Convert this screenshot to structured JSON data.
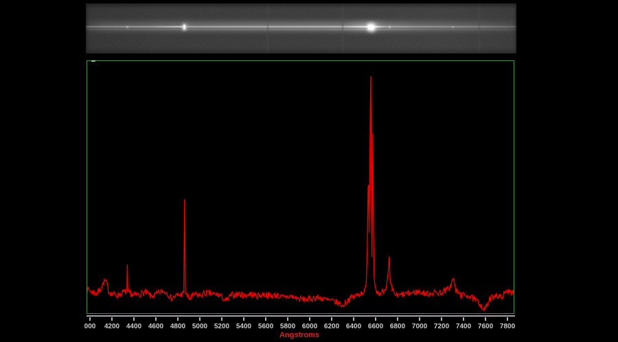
{
  "palette": {
    "background": "#000000",
    "strip_background": "#3b3b3b",
    "trace_white": "#ffffff",
    "plot_frame_green": "#3f9140",
    "spectrum_red": "#f20000",
    "axis_gray": "#a3a3a3",
    "tick_label_gray": "#cbcbcb",
    "xlabel_red": "#dd2222"
  },
  "strip": {
    "name": "2D spectrum strip image",
    "emission_knots": [
      {
        "lambda": 4340,
        "w": 3,
        "h": 3,
        "opacity": 0.35,
        "glow": 2
      },
      {
        "lambda": 4861,
        "w": 3,
        "h": 7,
        "opacity": 0.95,
        "glow": 3
      },
      {
        "lambda": 6541,
        "w": 3,
        "h": 7,
        "opacity": 1.0,
        "glow": 4
      },
      {
        "lambda": 6560,
        "w": 4,
        "h": 8,
        "opacity": 1.0,
        "glow": 5
      },
      {
        "lambda": 6579,
        "w": 3,
        "h": 6,
        "opacity": 0.95,
        "glow": 4
      },
      {
        "lambda": 6725,
        "w": 3,
        "h": 3,
        "opacity": 0.35,
        "glow": 2
      },
      {
        "lambda": 7306,
        "w": 3,
        "h": 3,
        "opacity": 0.25,
        "glow": 2
      }
    ],
    "vertical_streaks": [
      5612,
      6294,
      7537
    ]
  },
  "chart_data": {
    "type": "line",
    "title": "",
    "xlabel": "Angstroms",
    "ylabel": "",
    "x_range": [
      3975,
      7856
    ],
    "y_normalized_range": [
      0,
      1
    ],
    "grid": false,
    "legend": false,
    "line_color": "#f20000",
    "frame_color": "#3f9140",
    "x_ticks": {
      "values": [
        4000,
        4200,
        4400,
        4600,
        4800,
        5000,
        5200,
        5400,
        5600,
        5800,
        6000,
        6200,
        6400,
        6600,
        6800,
        7000,
        7200,
        7400,
        7600,
        7800
      ],
      "labels": [
        "000",
        "4200",
        "4400",
        "4600",
        "4800",
        "5000",
        "5200",
        "5400",
        "5600",
        "5800",
        "6000",
        "6200",
        "6400",
        "6600",
        "6800",
        "7000",
        "7200",
        "7400",
        "7600",
        "7800"
      ]
    },
    "noise_amplitude": 0.013,
    "series": [
      {
        "name": "intensity-profile",
        "points": [
          [
            3975,
            0.085
          ],
          [
            4020,
            0.075
          ],
          [
            4060,
            0.07
          ],
          [
            4100,
            0.09
          ],
          [
            4130,
            0.12
          ],
          [
            4150,
            0.115
          ],
          [
            4170,
            0.08
          ],
          [
            4210,
            0.07
          ],
          [
            4250,
            0.065
          ],
          [
            4300,
            0.08
          ],
          [
            4336,
            0.085
          ],
          [
            4340,
            0.18
          ],
          [
            4344,
            0.085
          ],
          [
            4390,
            0.07
          ],
          [
            4450,
            0.075
          ],
          [
            4500,
            0.085
          ],
          [
            4550,
            0.07
          ],
          [
            4600,
            0.075
          ],
          [
            4650,
            0.09
          ],
          [
            4700,
            0.085
          ],
          [
            4740,
            0.06
          ],
          [
            4790,
            0.07
          ],
          [
            4830,
            0.075
          ],
          [
            4854,
            0.08
          ],
          [
            4861,
            0.455
          ],
          [
            4868,
            0.08
          ],
          [
            4900,
            0.055
          ],
          [
            4950,
            0.07
          ],
          [
            5000,
            0.068
          ],
          [
            5060,
            0.075
          ],
          [
            5120,
            0.07
          ],
          [
            5180,
            0.065
          ],
          [
            5240,
            0.042
          ],
          [
            5290,
            0.065
          ],
          [
            5350,
            0.07
          ],
          [
            5400,
            0.065
          ],
          [
            5460,
            0.072
          ],
          [
            5520,
            0.065
          ],
          [
            5580,
            0.075
          ],
          [
            5640,
            0.07
          ],
          [
            5700,
            0.075
          ],
          [
            5760,
            0.068
          ],
          [
            5820,
            0.075
          ],
          [
            5880,
            0.07
          ],
          [
            5940,
            0.065
          ],
          [
            6000,
            0.068
          ],
          [
            6060,
            0.075
          ],
          [
            6120,
            0.07
          ],
          [
            6180,
            0.06
          ],
          [
            6240,
            0.055
          ],
          [
            6300,
            0.038
          ],
          [
            6350,
            0.06
          ],
          [
            6400,
            0.07
          ],
          [
            6450,
            0.078
          ],
          [
            6500,
            0.09
          ],
          [
            6515,
            0.12
          ],
          [
            6525,
            0.28
          ],
          [
            6531,
            0.5
          ],
          [
            6536,
            0.51
          ],
          [
            6541,
            0.32
          ],
          [
            6547,
            0.58
          ],
          [
            6552,
            0.82
          ],
          [
            6556,
            0.94
          ],
          [
            6561,
            0.5
          ],
          [
            6566,
            0.22
          ],
          [
            6571,
            0.45
          ],
          [
            6575,
            0.71
          ],
          [
            6580,
            0.33
          ],
          [
            6586,
            0.14
          ],
          [
            6596,
            0.1
          ],
          [
            6610,
            0.08
          ],
          [
            6640,
            0.075
          ],
          [
            6675,
            0.085
          ],
          [
            6700,
            0.11
          ],
          [
            6715,
            0.16
          ],
          [
            6725,
            0.22
          ],
          [
            6732,
            0.12
          ],
          [
            6750,
            0.085
          ],
          [
            6800,
            0.06
          ],
          [
            6850,
            0.07
          ],
          [
            6900,
            0.072
          ],
          [
            6950,
            0.078
          ],
          [
            7000,
            0.08
          ],
          [
            7060,
            0.073
          ],
          [
            7120,
            0.078
          ],
          [
            7180,
            0.08
          ],
          [
            7240,
            0.09
          ],
          [
            7285,
            0.11
          ],
          [
            7306,
            0.14
          ],
          [
            7330,
            0.09
          ],
          [
            7380,
            0.072
          ],
          [
            7440,
            0.075
          ],
          [
            7500,
            0.055
          ],
          [
            7550,
            0.04
          ],
          [
            7590,
            0.015
          ],
          [
            7640,
            0.055
          ],
          [
            7690,
            0.075
          ],
          [
            7730,
            0.06
          ],
          [
            7770,
            0.075
          ],
          [
            7820,
            0.09
          ],
          [
            7856,
            0.072
          ]
        ]
      }
    ]
  }
}
